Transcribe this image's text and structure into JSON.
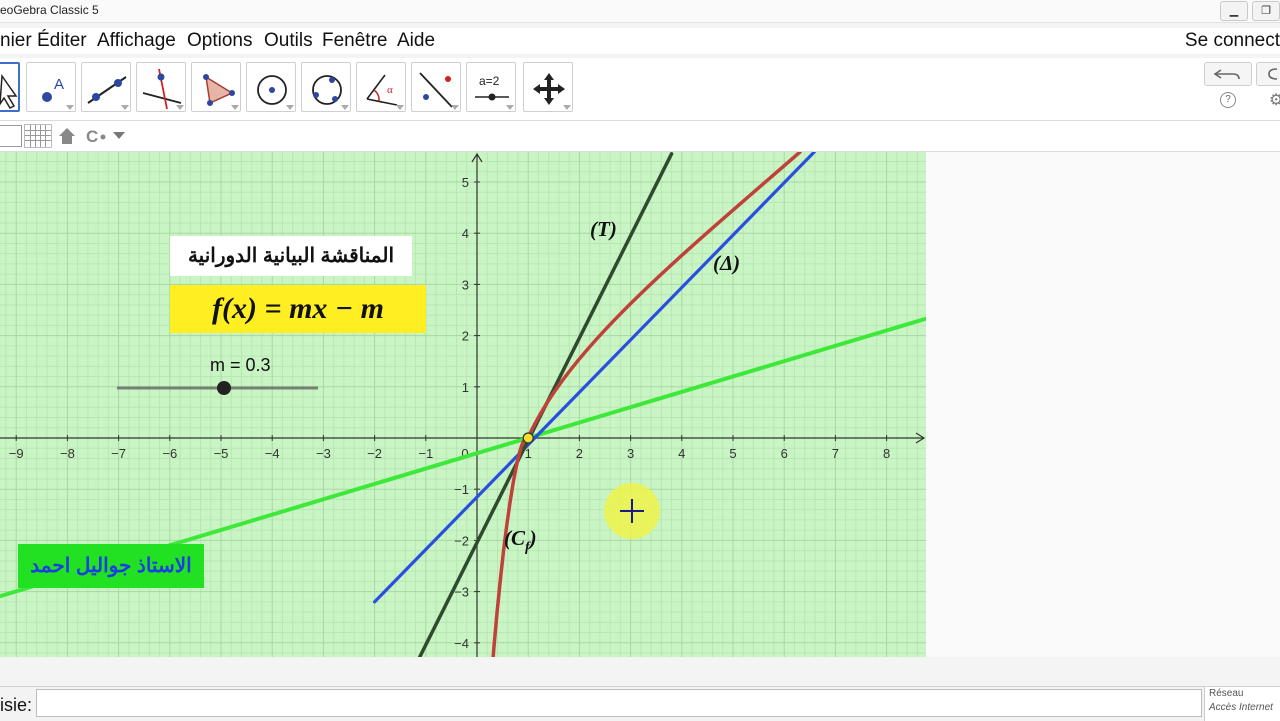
{
  "window": {
    "title": "eoGebra Classic 5"
  },
  "menu": {
    "items": [
      "nier",
      "Éditer",
      "Affichage",
      "Options",
      "Outils",
      "Fenêtre",
      "Aide"
    ],
    "signin": "Se connect"
  },
  "toolbar": {
    "tools": [
      "move-tool",
      "point-tool",
      "line-tool",
      "perpendicular-line-tool",
      "polygon-tool",
      "circle-tool",
      "conic-tool",
      "angle-tool",
      "reflect-tool",
      "slider-tool",
      "move-graphics-view-tool"
    ],
    "slider_icon_text": "a=2",
    "point_icon_text": "A",
    "angle_icon_text": "α",
    "help_text": "?"
  },
  "graphics": {
    "title_ar": "المناقشة البيانية الدورانية",
    "formula": "f(x) = mx − m",
    "slider_label": "m = 0.3",
    "slider_value": 0.3,
    "author_ar": "الاستاذ جواليل احمد",
    "label_T": "(T)",
    "label_delta": "(Δ)",
    "label_Cf_main": "(C",
    "label_Cf_sub": "f",
    "label_Cf_close": ")",
    "x_ticks": [
      "−9",
      "−8",
      "−7",
      "−6",
      "−5",
      "−4",
      "−3",
      "−2",
      "−1",
      "0",
      "1",
      "2",
      "3",
      "4",
      "5",
      "6",
      "7",
      "8"
    ],
    "y_ticks": [
      "5",
      "4",
      "3",
      "2",
      "1",
      "−1",
      "−2",
      "−3",
      "−4"
    ],
    "colors": {
      "background": "#c8f5c3",
      "T": "#2f4a2f",
      "Cf": "#c0403a",
      "delta": "#2a4fe0",
      "f_line": "#3ee83a",
      "formula_bg": "#ffee22",
      "author_bg": "#22e022",
      "author_text": "#1a3fe0"
    }
  },
  "status": {
    "input_label": "isie:",
    "network_title": "Réseau",
    "network_sub": "Accès Internet"
  }
}
